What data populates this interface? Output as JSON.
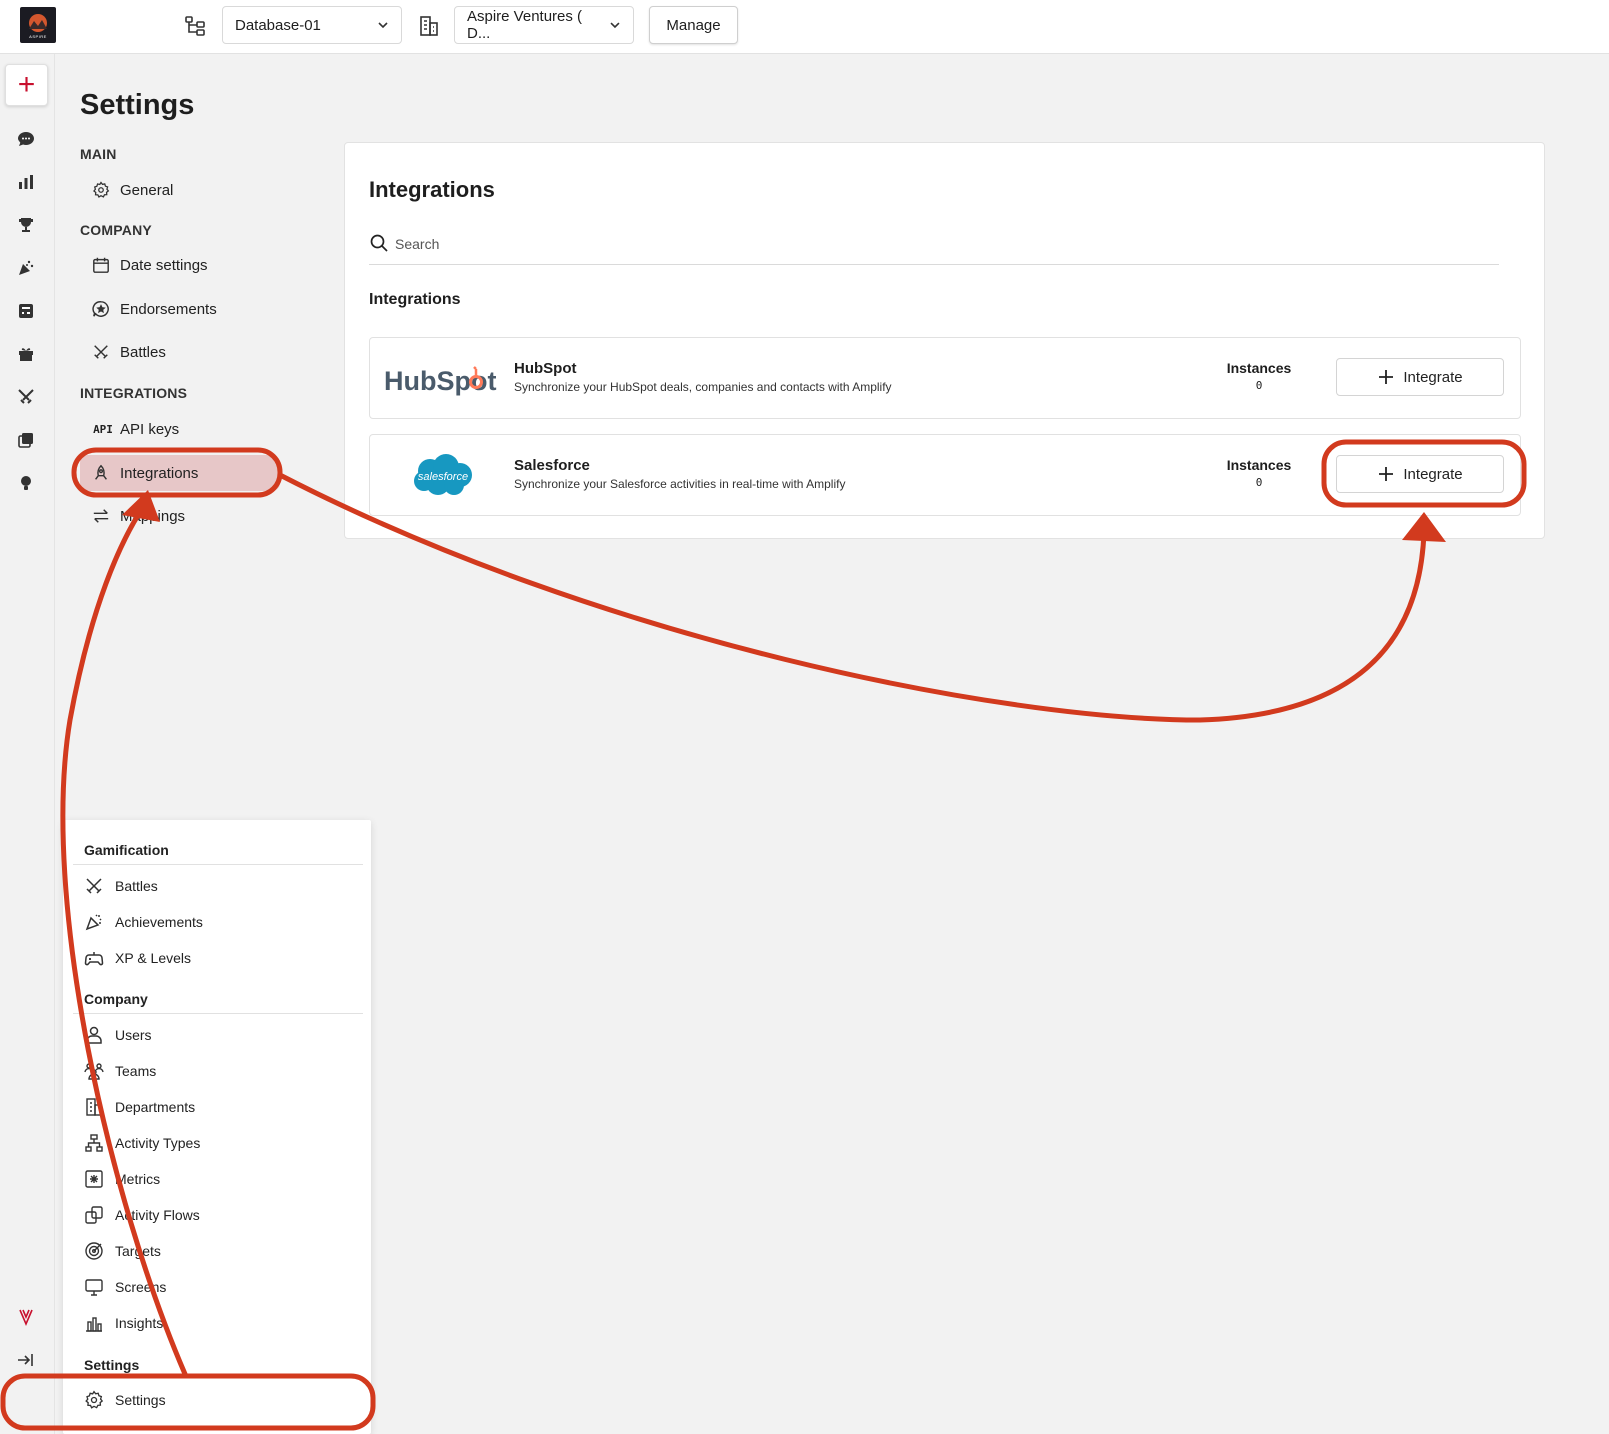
{
  "topbar": {
    "logo_text": "ASPIRE",
    "database_select": "Database-01",
    "company_select": "Aspire Ventures ( D...",
    "manage_label": "Manage"
  },
  "rail": {
    "add_label": "+",
    "icons": [
      "chat-icon",
      "bar-chart-icon",
      "trophy-icon",
      "confetti-icon",
      "calculator-icon",
      "gift-icon",
      "swords-icon",
      "cards-icon",
      "lightbulb-icon",
      "brand-icon",
      "collapse-icon",
      "settings-icon"
    ]
  },
  "settings": {
    "title": "Settings",
    "sections": [
      {
        "heading": "MAIN",
        "items": [
          {
            "label": "General",
            "icon": "gear-icon"
          }
        ]
      },
      {
        "heading": "COMPANY",
        "items": [
          {
            "label": "Date settings",
            "icon": "calendar-icon"
          },
          {
            "label": "Endorsements",
            "icon": "star-bubble-icon"
          },
          {
            "label": "Battles",
            "icon": "swords-icon"
          }
        ]
      },
      {
        "heading": "INTEGRATIONS",
        "items": [
          {
            "label": "API keys",
            "icon": "api-icon",
            "icon_text": "API"
          },
          {
            "label": "Integrations",
            "icon": "rocket-icon",
            "active": true
          },
          {
            "label": "Mappings",
            "icon": "arrows-icon"
          }
        ]
      }
    ]
  },
  "integrations": {
    "title": "Integrations",
    "search_placeholder": "Search",
    "list_title": "Integrations",
    "items": [
      {
        "name": "HubSpot",
        "description": "Synchronize your HubSpot deals, companies and contacts with Amplify",
        "instances_label": "Instances",
        "instances": "0",
        "button": "Integrate",
        "logo_text": "HubSpot"
      },
      {
        "name": "Salesforce",
        "description": "Synchronize your Salesforce activities in real-time with Amplify",
        "instances_label": "Instances",
        "instances": "0",
        "button": "Integrate",
        "logo_text": "salesforce"
      }
    ]
  },
  "menu": {
    "sections": [
      {
        "heading": "Gamification",
        "items": [
          {
            "label": "Battles",
            "icon": "swords-icon"
          },
          {
            "label": "Achievements",
            "icon": "confetti-icon"
          },
          {
            "label": "XP & Levels",
            "icon": "gamepad-icon"
          }
        ]
      },
      {
        "heading": "Company",
        "items": [
          {
            "label": "Users",
            "icon": "user-icon"
          },
          {
            "label": "Teams",
            "icon": "team-icon"
          },
          {
            "label": "Departments",
            "icon": "building-icon"
          },
          {
            "label": "Activity Types",
            "icon": "hierarchy-icon"
          },
          {
            "label": "Metrics",
            "icon": "metrics-icon"
          },
          {
            "label": "Activity Flows",
            "icon": "flows-icon"
          },
          {
            "label": "Targets",
            "icon": "target-icon"
          },
          {
            "label": "Screens",
            "icon": "monitor-icon"
          },
          {
            "label": "Insights",
            "icon": "insights-icon"
          }
        ]
      },
      {
        "heading": "Settings",
        "items": [
          {
            "label": "Settings",
            "icon": "gear-icon"
          }
        ]
      }
    ]
  },
  "colors": {
    "accent_red": "#c8102e",
    "annotation_red": "#d23a1e",
    "active_bg": "#e7c7c8",
    "hubspot_orange": "#ff7a59",
    "salesforce_blue": "#1798c1"
  }
}
